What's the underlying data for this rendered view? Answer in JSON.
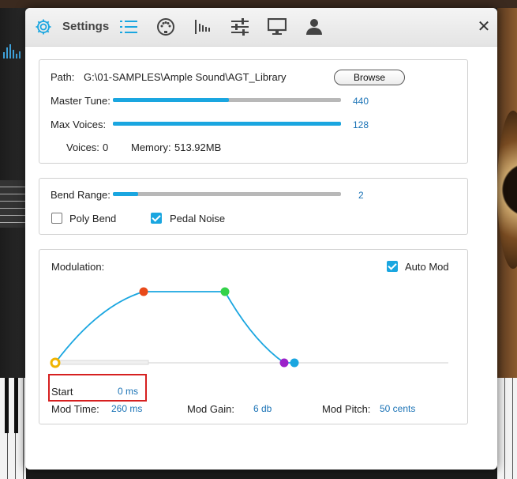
{
  "dialog": {
    "title": "Settings",
    "close_label": "✕",
    "tab_icons": [
      "gear-icon",
      "list-icon",
      "midi-port-icon",
      "waveform-icon",
      "sliders-icon",
      "monitor-icon",
      "user-icon"
    ]
  },
  "path_panel": {
    "path_label": "Path:",
    "path_value": "G:\\01-SAMPLES\\Ample Sound\\AGT_Library",
    "browse_label": "Browse",
    "master_tune_label": "Master Tune:",
    "master_tune_value": "440",
    "master_tune_fraction": 0.51,
    "max_voices_label": "Max Voices:",
    "max_voices_value": "128",
    "max_voices_fraction": 1.0,
    "voices_label": "Voices:",
    "voices_value": "0",
    "memory_label": "Memory:",
    "memory_value": "513.92MB"
  },
  "bend_panel": {
    "bend_range_label": "Bend Range:",
    "bend_range_value": "2",
    "bend_range_fraction": 0.11,
    "poly_bend_label": "Poly Bend",
    "poly_bend_checked": false,
    "pedal_noise_label": "Pedal Noise",
    "pedal_noise_checked": true
  },
  "modulation_panel": {
    "modulation_label": "Modulation:",
    "auto_mod_label": "Auto Mod",
    "auto_mod_checked": true,
    "start_label": "Start",
    "start_value": "0 ms",
    "mod_time_label": "Mod Time:",
    "mod_time_value": "260 ms",
    "mod_gain_label": "Mod Gain:",
    "mod_gain_value": "6 db",
    "mod_pitch_label": "Mod Pitch:",
    "mod_pitch_value": "50 cents"
  },
  "colors": {
    "accent": "#1aa6e0",
    "value_text": "#1b73b6",
    "node_start": "#f0b400",
    "node_attack": "#e84a1a",
    "node_hold": "#34d24a",
    "node_release": "#9b22c9",
    "node_end": "#1aa6e0",
    "highlight": "#d62020"
  }
}
